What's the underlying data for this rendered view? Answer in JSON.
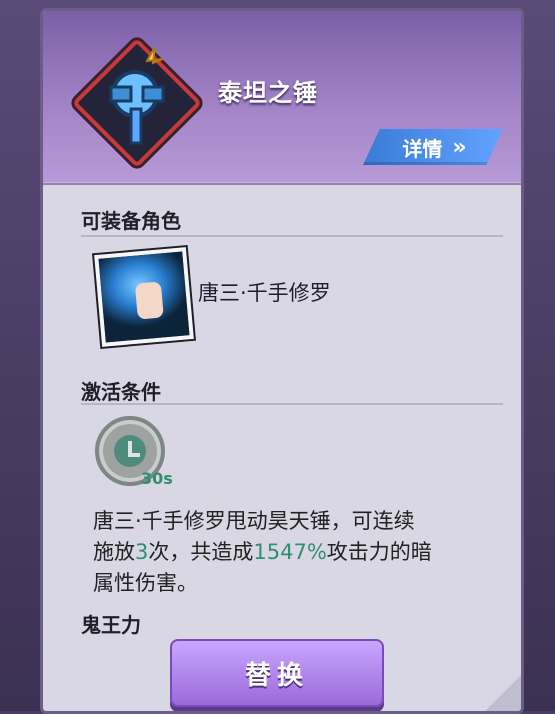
{
  "item": {
    "title": "泰坦之锤",
    "details_label": "详情",
    "details_icon": "double-chevron-right-icon"
  },
  "sections": {
    "equip_title": "可装备角色",
    "activate_title": "激活条件",
    "footer_label": "鬼王力"
  },
  "character": {
    "name": "唐三·千手修罗"
  },
  "condition": {
    "timer_label": "30s"
  },
  "description": {
    "line1": "唐三·千手修罗甩动昊天锤，可连续",
    "line2_prefix": "施放",
    "count": "3",
    "line2_mid": "次，共造成",
    "percent": "1547%",
    "line2_suffix": "攻击力的暗",
    "line3": "属性伤害。"
  },
  "buttons": {
    "replace_label": "替换"
  },
  "colors": {
    "accent_green": "#2f8f6e",
    "details_blue": "#4a8ff0",
    "button_purple": "#9c6ad9"
  }
}
